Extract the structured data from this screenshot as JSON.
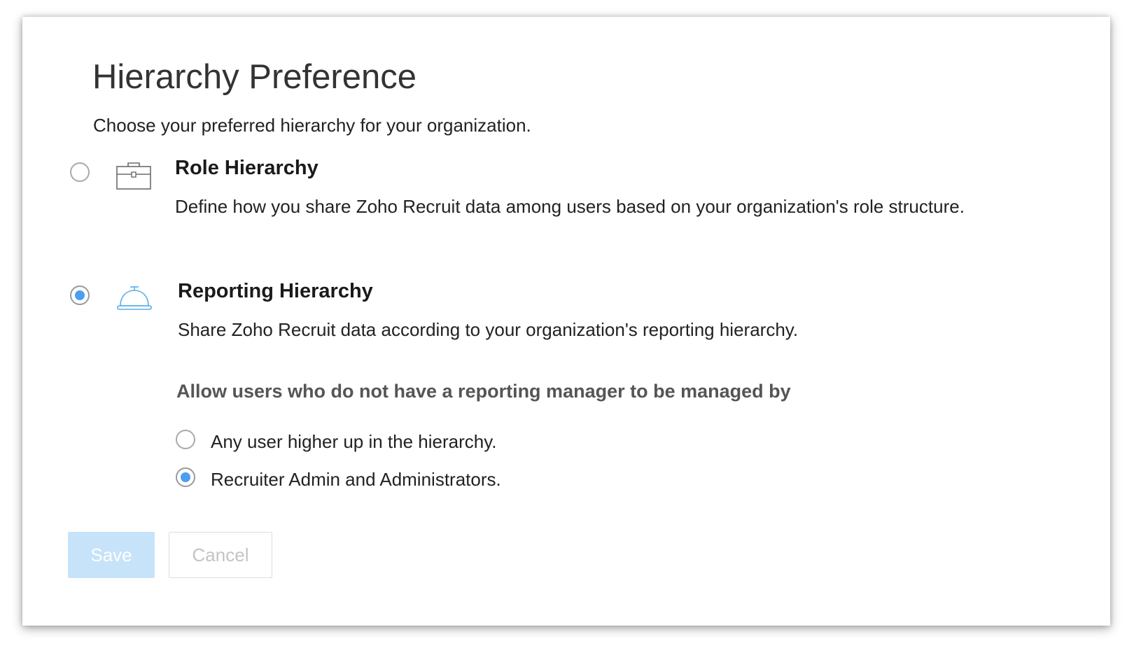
{
  "dialog": {
    "title": "Hierarchy Preference",
    "subtitle": "Choose your preferred hierarchy for your organization."
  },
  "options": [
    {
      "title": "Role Hierarchy",
      "description": "Define how you share Zoho Recruit data among users based on your organization's role structure.",
      "icon": "briefcase-icon",
      "selected": false
    },
    {
      "title": "Reporting Hierarchy",
      "description": "Share Zoho Recruit data according to your organization's reporting hierarchy.",
      "icon": "service-bell-icon",
      "selected": true
    }
  ],
  "reporting_settings": {
    "heading": "Allow users who do not have a reporting manager to be managed by",
    "choices": [
      {
        "label": "Any user higher up in the hierarchy.",
        "selected": false
      },
      {
        "label": "Recruiter Admin and Administrators.",
        "selected": true
      }
    ]
  },
  "actions": {
    "save_label": "Save",
    "cancel_label": "Cancel"
  },
  "colors": {
    "accent": "#4a9ff0",
    "save_disabled_bg": "#c6e3f9",
    "radio_border": "#a9a9a9",
    "heading_gray": "#555555"
  }
}
